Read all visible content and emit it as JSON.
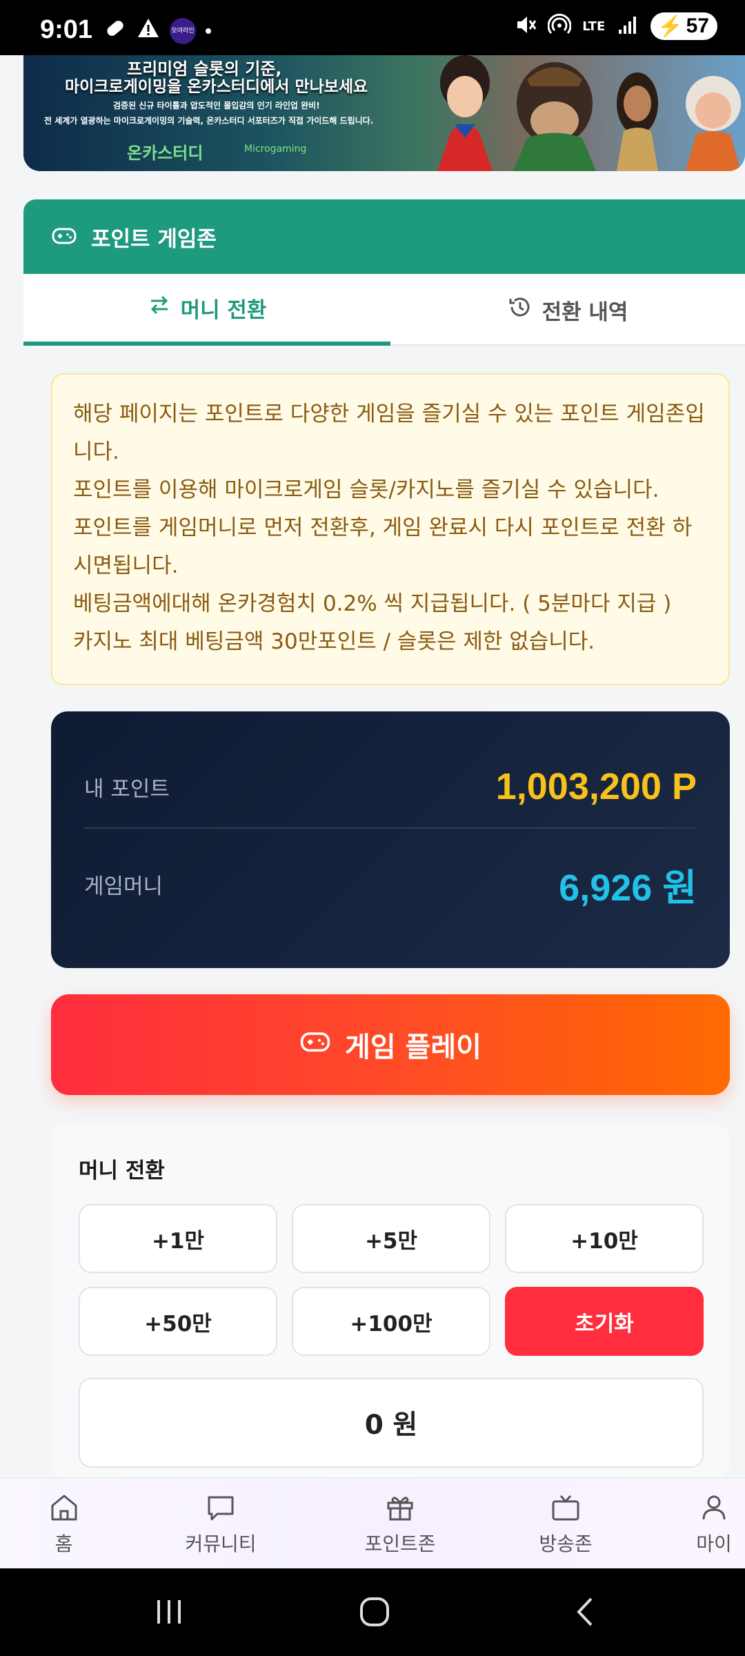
{
  "status_bar": {
    "time": "9:01",
    "app_badge": "모여라인",
    "network": "LTE",
    "battery": "57"
  },
  "banner": {
    "line1": "프리미엄 슬롯의 기준,",
    "line2": "마이크로게이밍을 온카스터디에서 만나보세요",
    "line3": "검증된 신규 타이틀과 압도적인 몰입감의 인기 라인업 완비!",
    "line4": "전 세계가 열광하는 마이크로게이밍의 기술력, 온카스터디 서포터즈가 직접 가이드해 드립니다.",
    "logo1": "온카스터디",
    "logo2": "Microgaming"
  },
  "header": {
    "title": "포인트 게임존"
  },
  "tabs": [
    {
      "label": "머니 전환",
      "active": true
    },
    {
      "label": "전환 내역",
      "active": false
    }
  ],
  "notice": {
    "lines": [
      "해당 페이지는 포인트로 다양한 게임을 즐기실 수 있는 포인트 게임존입니다.",
      "포인트를 이용해 마이크로게임 슬롯/카지노를 즐기실 수 있습니다.",
      "포인트를 게임머니로 먼저 전환후, 게임 완료시 다시 포인트로 전환 하시면됩니다.",
      "베팅금액에대해 온카경험치 0.2% 씩 지급됩니다. ( 5분마다 지급 )",
      "카지노 최대 베팅금액 30만포인트 / 슬롯은 제한 없습니다."
    ]
  },
  "balance": {
    "points_label": "내 포인트",
    "points_value": "1,003,200 P",
    "money_label": "게임머니",
    "money_value": "6,926 원"
  },
  "play_button": "게임 플레이",
  "conversion": {
    "title": "머니 전환",
    "buttons": [
      "+1만",
      "+5만",
      "+10만",
      "+50만",
      "+100만"
    ],
    "reset": "초기화",
    "total": "0 원"
  },
  "bottom_nav": [
    {
      "label": "홈",
      "icon": "home-icon"
    },
    {
      "label": "커뮤니티",
      "icon": "chat-icon"
    },
    {
      "label": "포인트존",
      "icon": "gift-icon"
    },
    {
      "label": "방송존",
      "icon": "tv-icon"
    },
    {
      "label": "마이",
      "icon": "user-icon"
    }
  ],
  "colors": {
    "accent": "#1e9a7f",
    "play_start": "#ff2d3d",
    "play_end": "#ff6a00",
    "points": "#f7c21b",
    "money": "#22c1e8"
  }
}
